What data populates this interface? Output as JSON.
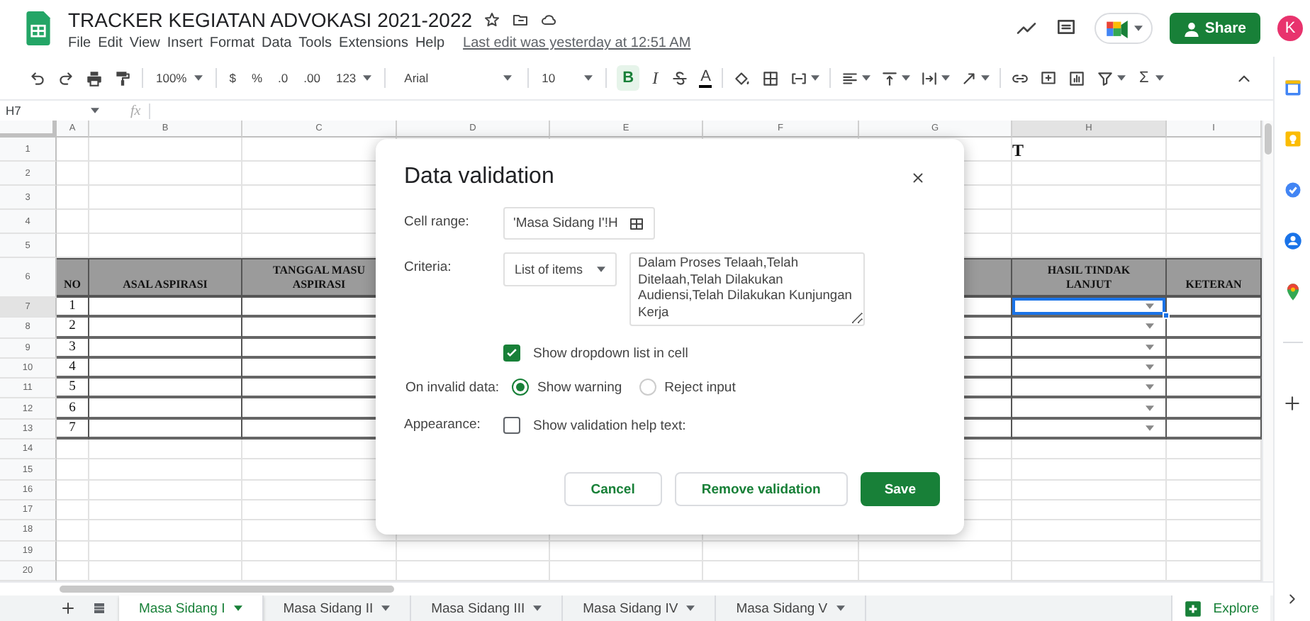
{
  "document": {
    "title": "TRACKER KEGIATAN ADVOKASI 2021-2022",
    "menu": [
      "File",
      "Edit",
      "View",
      "Insert",
      "Format",
      "Data",
      "Tools",
      "Extensions",
      "Help"
    ],
    "last_edit": "Last edit was yesterday at 12:51 AM",
    "share": "Share",
    "avatar": "K"
  },
  "toolbar": [
    {
      "items": [
        {
          "kind": "undo",
          "dropdown": false
        },
        {
          "kind": "redo",
          "dropdown": false
        },
        {
          "kind": "print",
          "dropdown": false
        },
        {
          "kind": "paint_format",
          "dropdown": false
        }
      ]
    },
    {
      "items": [
        {
          "kind": "zoom",
          "label": "100%",
          "dropdown": true
        }
      ]
    },
    {
      "items": [
        {
          "kind": "currency",
          "label": "$",
          "dropdown": false
        },
        {
          "kind": "percent",
          "label": "%",
          "dropdown": false
        },
        {
          "kind": "decimal_less",
          "label": ".0",
          "dropdown": false
        },
        {
          "kind": "decimal_more",
          "label": ".00",
          "dropdown": false
        },
        {
          "kind": "number_format",
          "label": "123",
          "dropdown": true
        }
      ]
    },
    {
      "items": [
        {
          "kind": "font",
          "label": "Arial",
          "dropdown": true
        }
      ]
    },
    {
      "items": [
        {
          "kind": "size",
          "label": "10",
          "dropdown": true
        }
      ]
    },
    {
      "items": [
        {
          "kind": "bold",
          "label": "B",
          "on": true,
          "dropdown": false
        },
        {
          "kind": "italic",
          "label": "I",
          "on": false,
          "dropdown": false
        },
        {
          "kind": "strike",
          "on": false,
          "dropdown": false
        },
        {
          "kind": "text_color",
          "label": "A",
          "on": false,
          "dropdown": false
        }
      ]
    },
    {
      "items": [
        {
          "kind": "fill_color",
          "dropdown": false
        },
        {
          "kind": "borders",
          "dropdown": false
        },
        {
          "kind": "merge",
          "dropdown": true
        }
      ]
    },
    {
      "items": [
        {
          "kind": "h_align",
          "dropdown": true
        },
        {
          "kind": "v_align",
          "dropdown": true
        },
        {
          "kind": "wrap",
          "dropdown": true
        },
        {
          "kind": "rotate",
          "dropdown": true
        }
      ]
    },
    {
      "items": [
        {
          "kind": "link",
          "dropdown": false
        },
        {
          "kind": "comment",
          "dropdown": false
        },
        {
          "kind": "chart",
          "dropdown": false
        },
        {
          "kind": "filter",
          "dropdown": true
        },
        {
          "kind": "functions",
          "label": "Σ",
          "dropdown": true
        }
      ]
    }
  ],
  "formula_bar": {
    "cell": "H7",
    "fx": "fx"
  },
  "sheet": {
    "columns": [
      {
        "letter": "A",
        "selected": false
      },
      {
        "letter": "B",
        "selected": false
      },
      {
        "letter": "C",
        "selected": false
      },
      {
        "letter": "D",
        "selected": false
      },
      {
        "letter": "E",
        "selected": false
      },
      {
        "letter": "F",
        "selected": false
      },
      {
        "letter": "G",
        "selected": false
      },
      {
        "letter": "H",
        "selected": true
      },
      {
        "letter": "I",
        "selected": false
      }
    ],
    "rows": [
      {
        "number": "1",
        "kind": "plain",
        "selected": false,
        "title": "T"
      },
      {
        "number": "2",
        "kind": "plain",
        "selected": false
      },
      {
        "number": "3",
        "kind": "plain",
        "selected": false
      },
      {
        "number": "4",
        "kind": "plain",
        "selected": false
      },
      {
        "number": "5",
        "kind": "plain",
        "selected": false
      },
      {
        "number": "6",
        "kind": "header",
        "selected": false,
        "cells": [
          {
            "kind": "text",
            "text": "NO"
          },
          {
            "kind": "text",
            "text": "ASAL ASPIRASI"
          },
          {
            "kind": "text",
            "text": "TANGGAL MASU\nASPIRASI"
          },
          {
            "kind": "blank"
          },
          {
            "kind": "blank"
          },
          {
            "kind": "blank"
          },
          {
            "kind": "blank"
          },
          {
            "kind": "text",
            "text": "HASIL TINDAK\nLANJUT"
          },
          {
            "kind": "text",
            "text": "KETERAN"
          }
        ]
      },
      {
        "number": "7",
        "kind": "data",
        "selected": true,
        "cells": [
          {
            "kind": "text",
            "text": "1"
          },
          {
            "kind": "blank"
          },
          {
            "kind": "blank"
          },
          {
            "kind": "blank"
          },
          {
            "kind": "blank"
          },
          {
            "kind": "blank"
          },
          {
            "kind": "blank"
          },
          {
            "kind": "dropdown"
          },
          {
            "kind": "blank"
          }
        ]
      },
      {
        "number": "8",
        "kind": "data",
        "selected": false,
        "cells": [
          {
            "kind": "text",
            "text": "2"
          },
          {
            "kind": "blank"
          },
          {
            "kind": "blank"
          },
          {
            "kind": "blank"
          },
          {
            "kind": "blank"
          },
          {
            "kind": "blank"
          },
          {
            "kind": "blank"
          },
          {
            "kind": "dropdown"
          },
          {
            "kind": "blank"
          }
        ]
      },
      {
        "number": "9",
        "kind": "data",
        "selected": false,
        "cells": [
          {
            "kind": "text",
            "text": "3"
          },
          {
            "kind": "blank"
          },
          {
            "kind": "blank"
          },
          {
            "kind": "blank"
          },
          {
            "kind": "blank"
          },
          {
            "kind": "blank"
          },
          {
            "kind": "blank"
          },
          {
            "kind": "dropdown"
          },
          {
            "kind": "blank"
          }
        ]
      },
      {
        "number": "10",
        "kind": "data",
        "selected": false,
        "cells": [
          {
            "kind": "text",
            "text": "4"
          },
          {
            "kind": "blank"
          },
          {
            "kind": "blank"
          },
          {
            "kind": "blank"
          },
          {
            "kind": "blank"
          },
          {
            "kind": "blank"
          },
          {
            "kind": "blank"
          },
          {
            "kind": "dropdown"
          },
          {
            "kind": "blank"
          }
        ]
      },
      {
        "number": "11",
        "kind": "data",
        "selected": false,
        "cells": [
          {
            "kind": "text",
            "text": "5"
          },
          {
            "kind": "blank"
          },
          {
            "kind": "blank"
          },
          {
            "kind": "blank"
          },
          {
            "kind": "blank"
          },
          {
            "kind": "blank"
          },
          {
            "kind": "blank"
          },
          {
            "kind": "dropdown"
          },
          {
            "kind": "blank"
          }
        ]
      },
      {
        "number": "12",
        "kind": "data",
        "selected": false,
        "cells": [
          {
            "kind": "text",
            "text": "6"
          },
          {
            "kind": "blank"
          },
          {
            "kind": "blank"
          },
          {
            "kind": "blank"
          },
          {
            "kind": "blank"
          },
          {
            "kind": "blank"
          },
          {
            "kind": "blank"
          },
          {
            "kind": "dropdown"
          },
          {
            "kind": "blank"
          }
        ]
      },
      {
        "number": "13",
        "kind": "data",
        "selected": false,
        "cells": [
          {
            "kind": "text",
            "text": "7"
          },
          {
            "kind": "blank"
          },
          {
            "kind": "blank"
          },
          {
            "kind": "blank"
          },
          {
            "kind": "blank"
          },
          {
            "kind": "blank"
          },
          {
            "kind": "blank"
          },
          {
            "kind": "dropdown"
          },
          {
            "kind": "blank"
          }
        ]
      },
      {
        "number": "14",
        "kind": "plain",
        "selected": false
      },
      {
        "number": "15",
        "kind": "plain",
        "selected": false
      },
      {
        "number": "16",
        "kind": "plain",
        "selected": false
      },
      {
        "number": "17",
        "kind": "plain",
        "selected": false
      },
      {
        "number": "18",
        "kind": "plain",
        "selected": false
      },
      {
        "number": "19",
        "kind": "plain",
        "selected": false
      },
      {
        "number": "20",
        "kind": "plain",
        "selected": false
      }
    ]
  },
  "dialog": {
    "title": "Data validation",
    "cell_range": {
      "label": "Cell range:",
      "value": "'Masa Sidang I'!H"
    },
    "criteria": {
      "label": "Criteria:",
      "type": "List of items",
      "items": "Dalam Proses Telaah,Telah Ditelaah,Telah Dilakukan Audiensi,Telah Dilakukan Kunjungan Kerja"
    },
    "show_dropdown": {
      "label": "Show dropdown list in cell",
      "checked": true
    },
    "invalid_data": {
      "label": "On invalid data:",
      "options": [
        {
          "label": "Show warning",
          "selected": true
        },
        {
          "label": "Reject input",
          "selected": false
        }
      ]
    },
    "appearance": {
      "label": "Appearance:",
      "option": {
        "label": "Show validation help text:",
        "checked": false
      }
    },
    "buttons": [
      {
        "label": "Cancel",
        "kind": "secondary"
      },
      {
        "label": "Remove validation",
        "kind": "secondary"
      },
      {
        "label": "Save",
        "kind": "primary"
      }
    ]
  },
  "tabs": [
    {
      "label": "Masa Sidang I",
      "selected": true
    },
    {
      "label": "Masa Sidang II",
      "selected": false
    },
    {
      "label": "Masa Sidang III",
      "selected": false
    },
    {
      "label": "Masa Sidang IV",
      "selected": false
    },
    {
      "label": "Masa Sidang V",
      "selected": false
    }
  ],
  "explore": "Explore"
}
